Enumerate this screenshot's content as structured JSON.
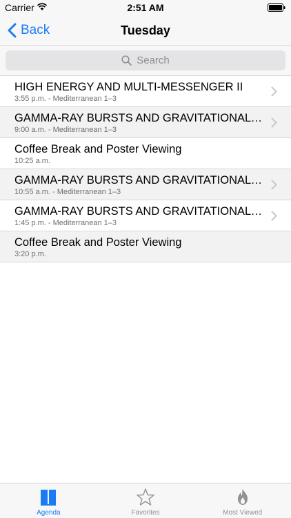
{
  "status_bar": {
    "carrier": "Carrier",
    "time": "2:51 AM"
  },
  "nav": {
    "back_label": "Back",
    "title": "Tuesday"
  },
  "search": {
    "placeholder": "Search"
  },
  "sessions": [
    {
      "title": "HIGH ENERGY AND MULTI-MESSENGER II",
      "subtitle": "3:55 p.m. - Mediterranean 1–3",
      "has_chevron": true,
      "shaded": false
    },
    {
      "title": "GAMMA-RAY BURSTS AND GRAVITATIONAL W…",
      "subtitle": "9:00 a.m. - Mediterranean 1–3",
      "has_chevron": true,
      "shaded": true
    },
    {
      "title": "Coffee Break and Poster Viewing",
      "subtitle": "10:25 a.m.",
      "has_chevron": false,
      "shaded": false
    },
    {
      "title": "GAMMA-RAY BURSTS AND GRAVITATIONAL W…",
      "subtitle": "10:55 a.m. - Mediterranean 1–3",
      "has_chevron": true,
      "shaded": true
    },
    {
      "title": "GAMMA-RAY BURSTS AND GRAVITATIONAL W…",
      "subtitle": "1:45 p.m. - Mediterranean 1–3",
      "has_chevron": true,
      "shaded": false
    },
    {
      "title": "Coffee Break and Poster Viewing",
      "subtitle": "3:20 p.m.",
      "has_chevron": false,
      "shaded": true
    }
  ],
  "tabs": [
    {
      "label": "Agenda",
      "icon": "book-icon",
      "active": true
    },
    {
      "label": "Favorites",
      "icon": "star-icon",
      "active": false
    },
    {
      "label": "Most Viewed",
      "icon": "flame-icon",
      "active": false
    }
  ],
  "colors": {
    "accent": "#1a7cf5",
    "inactive": "#929292",
    "shaded_row": "#f2f2f3"
  }
}
